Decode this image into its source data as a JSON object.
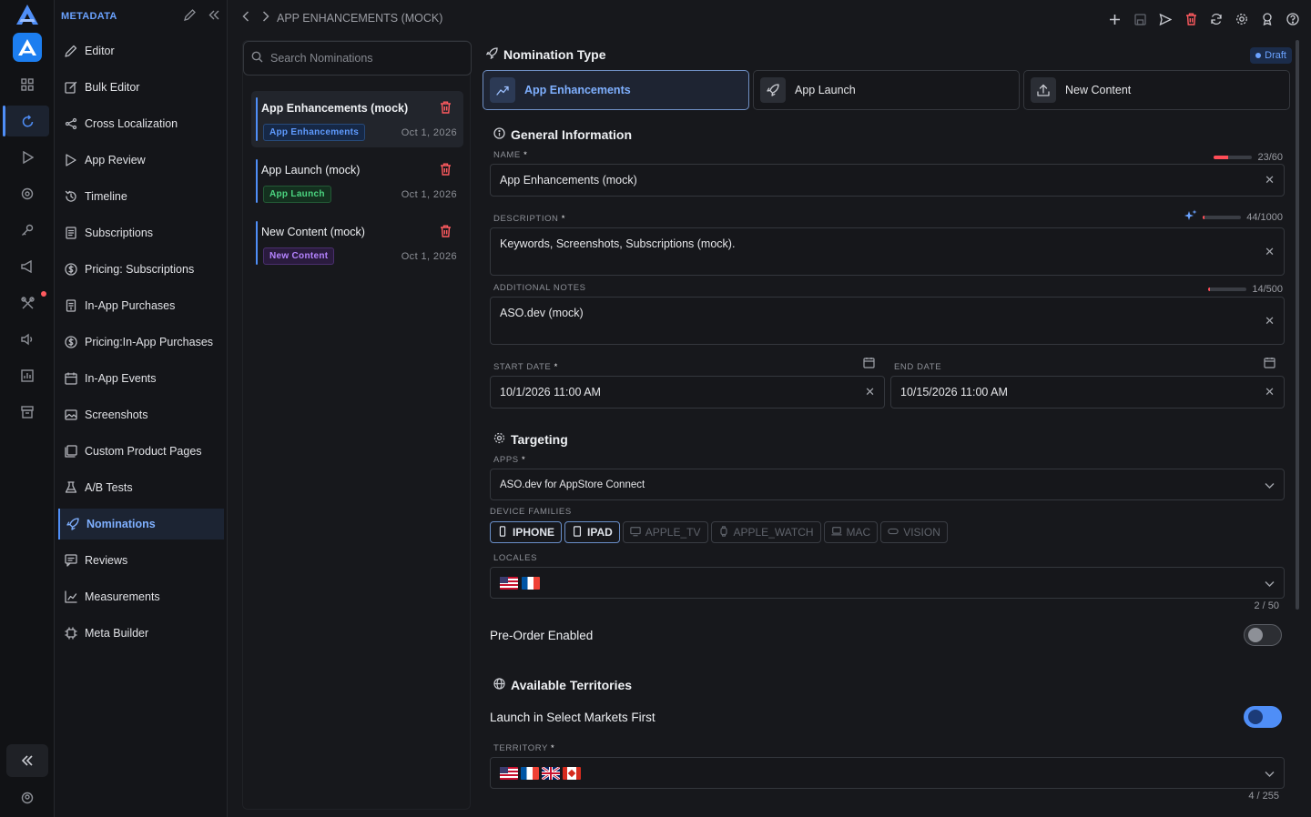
{
  "rail": {
    "icons": [
      "logo-icon",
      "app-icon",
      "grid-icon",
      "refresh-icon",
      "play-icon",
      "eye-icon",
      "key-icon",
      "megaphone-icon",
      "tools-icon",
      "volume-icon",
      "chart-icon",
      "archive-icon"
    ],
    "collapse_icon": "double-chevron-left-icon"
  },
  "sidebar": {
    "section_title": "METADATA",
    "items": [
      {
        "label": "Editor",
        "icon": "pencil-icon"
      },
      {
        "label": "Bulk Editor",
        "icon": "edit-box-icon"
      },
      {
        "label": "Cross Localization",
        "icon": "share-icon"
      },
      {
        "label": "App Review",
        "icon": "play-icon"
      },
      {
        "label": "Timeline",
        "icon": "history-icon"
      },
      {
        "label": "Subscriptions",
        "icon": "document-icon"
      },
      {
        "label": "Pricing: Subscriptions",
        "icon": "dollar-icon"
      },
      {
        "label": "In-App Purchases",
        "icon": "receipt-icon"
      },
      {
        "label": "Pricing:In-App Purchases",
        "icon": "dollar-icon"
      },
      {
        "label": "In-App Events",
        "icon": "calendar-icon"
      },
      {
        "label": "Screenshots",
        "icon": "image-icon"
      },
      {
        "label": "Custom Product Pages",
        "icon": "pages-icon"
      },
      {
        "label": "A/B Tests",
        "icon": "flask-icon"
      },
      {
        "label": "Nominations",
        "icon": "rocket-icon",
        "active": true
      },
      {
        "label": "Reviews",
        "icon": "review-icon"
      },
      {
        "label": "Measurements",
        "icon": "chart-icon"
      },
      {
        "label": "Meta Builder",
        "icon": "chip-icon"
      }
    ]
  },
  "breadcrumb": {
    "title": "APP ENHANCEMENTS (MOCK)"
  },
  "search": {
    "placeholder": "Search Nominations"
  },
  "nominations": [
    {
      "title": "App Enhancements (mock)",
      "badge": "App Enhancements",
      "date": "Oct 1, 2026",
      "badge_color": "#5f9bff"
    },
    {
      "title": "App Launch (mock)",
      "badge": "App Launch",
      "date": "Oct 1, 2026",
      "badge_color": "#4cd681"
    },
    {
      "title": "New Content (mock)",
      "badge": "New Content",
      "date": "Oct 1, 2026",
      "badge_color": "#b583ff"
    }
  ],
  "main": {
    "nomination_type_heading": "Nomination Type",
    "status_badge": "Draft",
    "types": [
      {
        "label": "App Enhancements",
        "icon": "trend-up-icon",
        "active": true
      },
      {
        "label": "App Launch",
        "icon": "rocket-icon"
      },
      {
        "label": "New Content",
        "icon": "upload-icon"
      }
    ],
    "general_heading": "General Information",
    "name_label": "NAME",
    "name_value": "App Enhancements (mock)",
    "name_counter": "23/60",
    "name_progress": 0.38,
    "description_label": "DESCRIPTION",
    "description_value": "Keywords, Screenshots, Subscriptions (mock).",
    "description_counter": "44/1000",
    "description_progress": 0.044,
    "notes_label": "ADDITIONAL NOTES",
    "notes_value": "ASO.dev (mock)",
    "notes_counter": "14/500",
    "notes_progress": 0.028,
    "start_label": "START DATE",
    "start_value": "10/1/2026 11:00 AM",
    "end_label": "END DATE",
    "end_value": "10/15/2026 11:00 AM",
    "targeting_heading": "Targeting",
    "apps_label": "APPS",
    "apps_value": "ASO.dev for AppStore Connect",
    "devices_label": "DEVICE FAMILIES",
    "devices": [
      {
        "label": "IPHONE",
        "on": true
      },
      {
        "label": "IPAD",
        "on": true
      },
      {
        "label": "APPLE_TV",
        "on": false
      },
      {
        "label": "APPLE_WATCH",
        "on": false
      },
      {
        "label": "MAC",
        "on": false
      },
      {
        "label": "VISION",
        "on": false
      }
    ],
    "locales_label": "LOCALES",
    "locales_counter": "2 / 50",
    "preorder_label": "Pre-Order Enabled",
    "preorder_on": false,
    "territories_heading": "Available Territories",
    "select_markets_label": "Launch in Select Markets First",
    "select_markets_on": true,
    "territory_label": "TERRITORY",
    "territory_counter": "4 / 255"
  },
  "colors": {
    "accent": "#4f8ef7",
    "danger": "#ff5a5f"
  }
}
